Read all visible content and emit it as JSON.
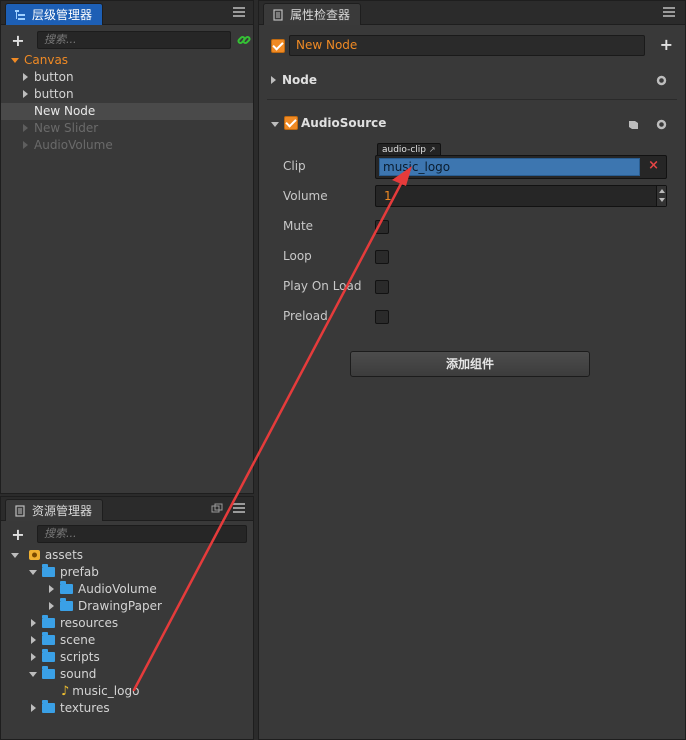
{
  "hierarchy": {
    "tab_label": "层级管理器",
    "search_placeholder": "搜索...",
    "items": [
      {
        "label": "Canvas"
      },
      {
        "label": "button"
      },
      {
        "label": "button"
      },
      {
        "label": "New Node"
      },
      {
        "label": "New Slider"
      },
      {
        "label": "AudioVolume"
      }
    ]
  },
  "assets": {
    "tab_label": "资源管理器",
    "search_placeholder": "搜索...",
    "items": [
      {
        "label": "assets"
      },
      {
        "label": "prefab"
      },
      {
        "label": "AudioVolume"
      },
      {
        "label": "DrawingPaper"
      },
      {
        "label": "resources"
      },
      {
        "label": "scene"
      },
      {
        "label": "scripts"
      },
      {
        "label": "sound"
      },
      {
        "label": "music_logo"
      },
      {
        "label": "textures"
      }
    ]
  },
  "inspector": {
    "tab_label": "属性检查器",
    "node_name": "New Node",
    "node_section": "Node",
    "component": {
      "name": "AudioSource",
      "clip_label": "Clip",
      "clip_type_badge": "audio-clip",
      "clip_value": "music_logo",
      "clip_clear": "×",
      "volume_label": "Volume",
      "volume_value": "1",
      "mute_label": "Mute",
      "loop_label": "Loop",
      "play_on_load_label": "Play On Load",
      "preload_label": "Preload"
    },
    "add_component_label": "添加组件"
  },
  "colors": {
    "accent_blue": "#1d5fb5",
    "accent_orange": "#f08a24",
    "arrow_red": "#e53b3b"
  }
}
